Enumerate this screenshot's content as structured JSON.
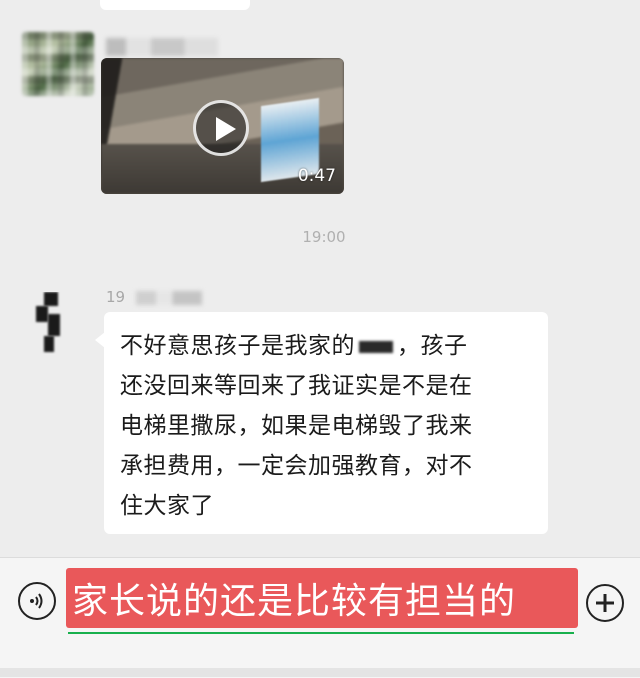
{
  "chat": {
    "messages": [
      {
        "type": "video",
        "sender_name": "",
        "duration": "0:47"
      },
      {
        "type": "timestamp",
        "text": "19:00"
      },
      {
        "type": "text",
        "sender_prefix": "19",
        "lines": [
          "不好意思孩子是我家的",
          "孩子",
          "还没回来等回来了我证实是不是在",
          "电梯里撒尿，如果是电梯毁了我来",
          "承担费用，一定会加强教育，对不",
          "住大家了"
        ]
      }
    ]
  },
  "input_bar": {
    "caption": "家长说的还是比较有担当的",
    "voice_icon": "voice-icon",
    "plus_icon": "plus-icon"
  },
  "colors": {
    "chat_background": "#ededed",
    "bubble": "#ffffff",
    "caption_background": "#e9585a",
    "input_accent": "#18b04d"
  }
}
